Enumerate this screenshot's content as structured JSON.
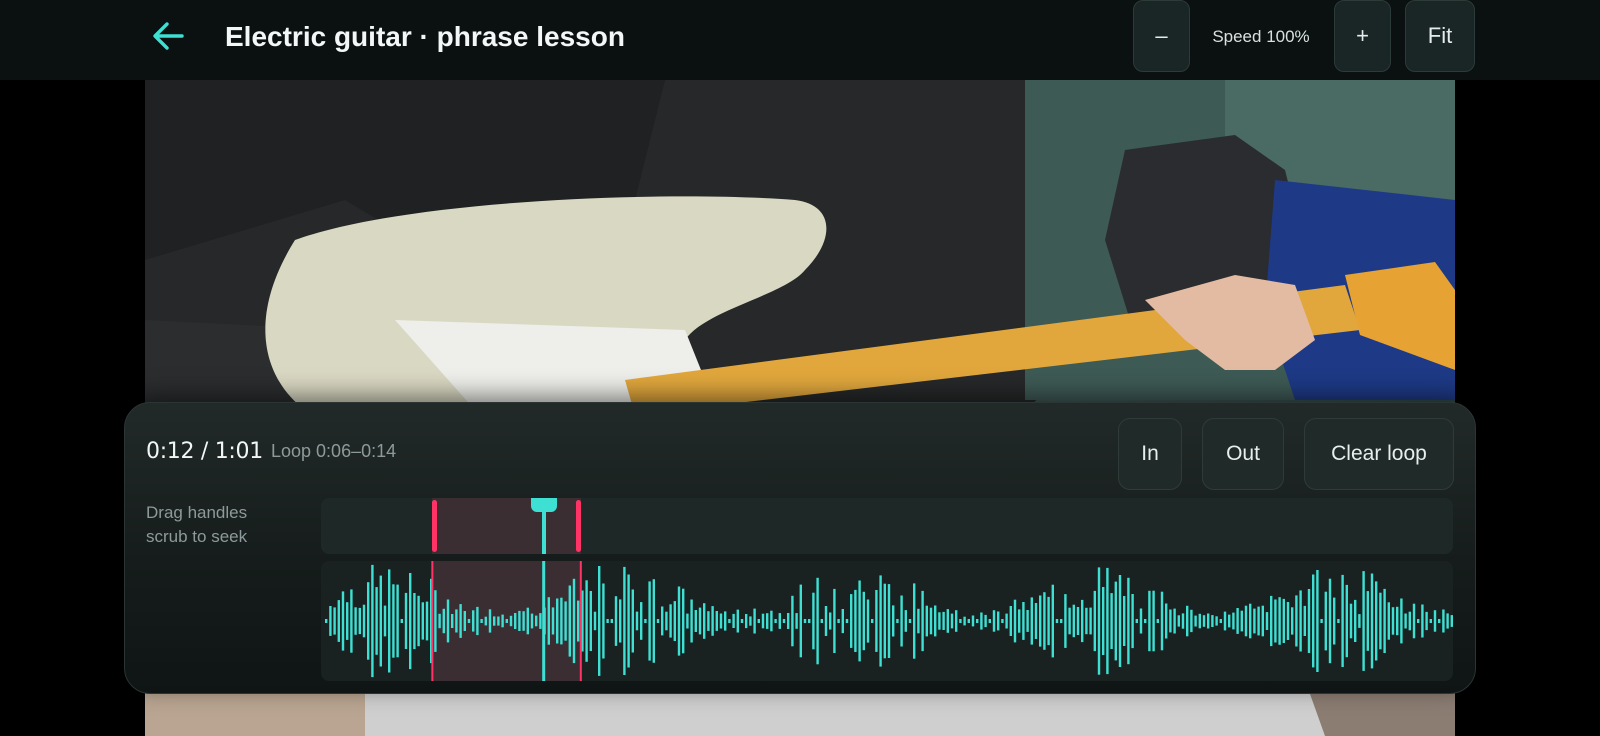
{
  "header": {
    "title": "Electric guitar · phrase lesson",
    "back_icon": "arrow-left-icon",
    "speed_down_label": "–",
    "speed_label": "Speed 100%",
    "speed_up_label": "+",
    "fit_label": "Fit"
  },
  "player": {
    "time_readout": "0:12 / 1:01",
    "loop_readout": "Loop 0:06–0:14",
    "in_label": "In",
    "out_label": "Out",
    "clear_label": "Clear loop",
    "hint_line1": "Drag handles",
    "hint_line2": "scrub to seek",
    "duration_s": 61,
    "current_s": 12,
    "loop_in_s": 6,
    "loop_out_s": 14
  },
  "colors": {
    "accent": "#3ee0d4",
    "loop_handle": "#ff3366",
    "loop_region": "#3a2e33"
  }
}
